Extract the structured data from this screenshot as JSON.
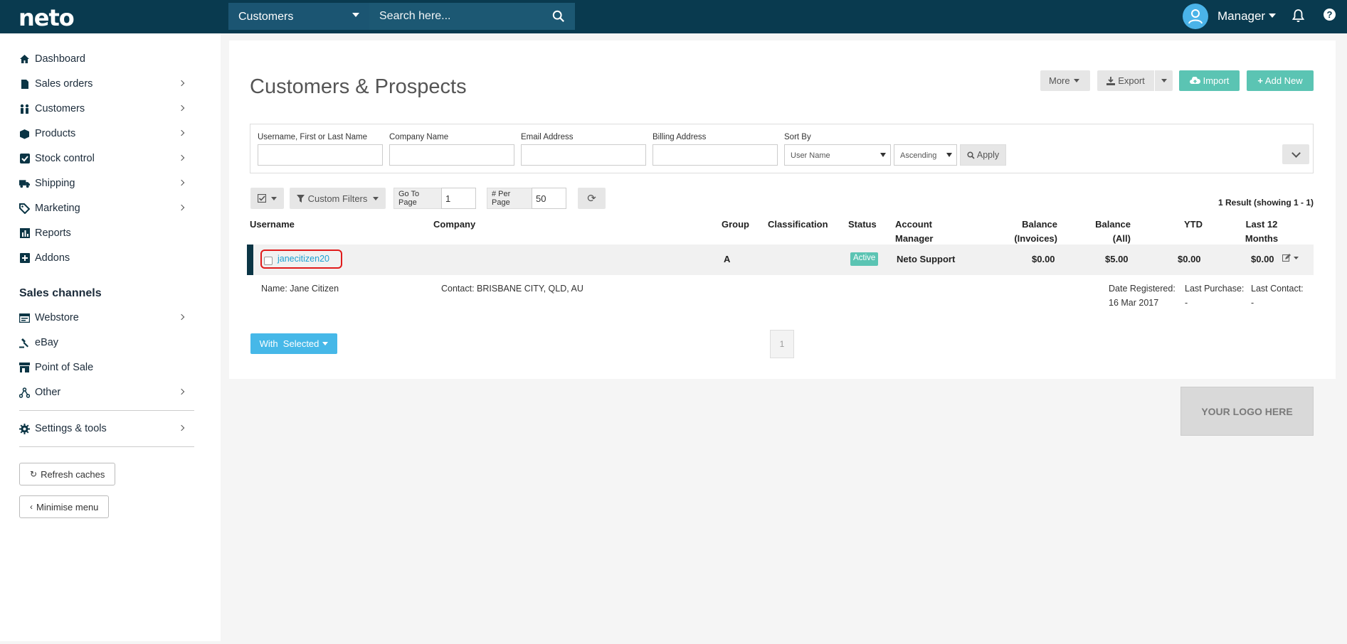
{
  "topbar": {
    "logo": "neto",
    "search_scope": "Customers",
    "search_placeholder": "Search here...",
    "user": "Manager"
  },
  "sidebar": {
    "items": [
      {
        "label": "Dashboard",
        "icon": "home-icon"
      },
      {
        "label": "Sales orders",
        "icon": "document-icon"
      },
      {
        "label": "Customers",
        "icon": "people-icon"
      },
      {
        "label": "Products",
        "icon": "box-icon"
      },
      {
        "label": "Stock control",
        "icon": "checkbox-icon"
      },
      {
        "label": "Shipping",
        "icon": "truck-icon"
      },
      {
        "label": "Marketing",
        "icon": "tag-icon"
      },
      {
        "label": "Reports",
        "icon": "bar-chart-icon"
      },
      {
        "label": "Addons",
        "icon": "plus-square-icon"
      }
    ],
    "channels_title": "Sales channels",
    "channels": [
      {
        "label": "Webstore",
        "icon": "browser-icon"
      },
      {
        "label": "eBay",
        "icon": "gavel-icon"
      },
      {
        "label": "Point of Sale",
        "icon": "store-icon"
      },
      {
        "label": "Other",
        "icon": "network-icon"
      }
    ],
    "settings": "Settings & tools",
    "refresh": "Refresh caches",
    "minimise": "Minimise menu"
  },
  "main": {
    "title": "Customers & Prospects",
    "buttons": {
      "more": "More",
      "export": "Export",
      "import": "Import",
      "add_new": "Add New"
    },
    "filters": {
      "username_label": "Username, First or Last Name",
      "company_label": "Company Name",
      "email_label": "Email Address",
      "billing_label": "Billing Address",
      "sort_label": "Sort By",
      "sort_value": "User Name",
      "order_value": "Ascending",
      "apply": "Apply"
    },
    "toolbar": {
      "custom_filters": "Custom Filters",
      "go_to_page_label": "Go To Page",
      "go_to_page_value": "1",
      "per_page_label": "# Per Page",
      "per_page_value": "50",
      "result_count": "1 Result (showing 1 - 1)"
    },
    "columns": {
      "username": "Username",
      "company": "Company",
      "group": "Group",
      "classification": "Classification",
      "status": "Status",
      "account_manager_1": "Account",
      "account_manager_2": "Manager",
      "balance_invoices_1": "Balance",
      "balance_invoices_2": "(Invoices)",
      "balance_all_1": "Balance",
      "balance_all_2": "(All)",
      "ytd": "YTD",
      "last12_1": "Last 12",
      "last12_2": "Months"
    },
    "row": {
      "username": "janecitizen20",
      "group": "A",
      "status": "Active",
      "account_manager": "Neto Support",
      "balance_invoices": "$0.00",
      "balance_all": "$5.00",
      "ytd": "$0.00",
      "last12": "$0.00",
      "name": "Name: Jane Citizen",
      "contact": "Contact: BRISBANE CITY, QLD, AU",
      "date_registered_label": "Date Registered:",
      "date_registered": "16 Mar 2017",
      "last_purchase_label": "Last Purchase:",
      "last_purchase": "-",
      "last_contact_label": "Last Contact:",
      "last_contact": "-"
    },
    "with_selected": "With  Selected",
    "page": "1",
    "logo_placeholder": "YOUR LOGO HERE"
  },
  "colors": {
    "topbar": "#093a4f",
    "teal": "#5bc4b3",
    "link": "#1da1d3",
    "blue_button": "#46b8e8"
  }
}
